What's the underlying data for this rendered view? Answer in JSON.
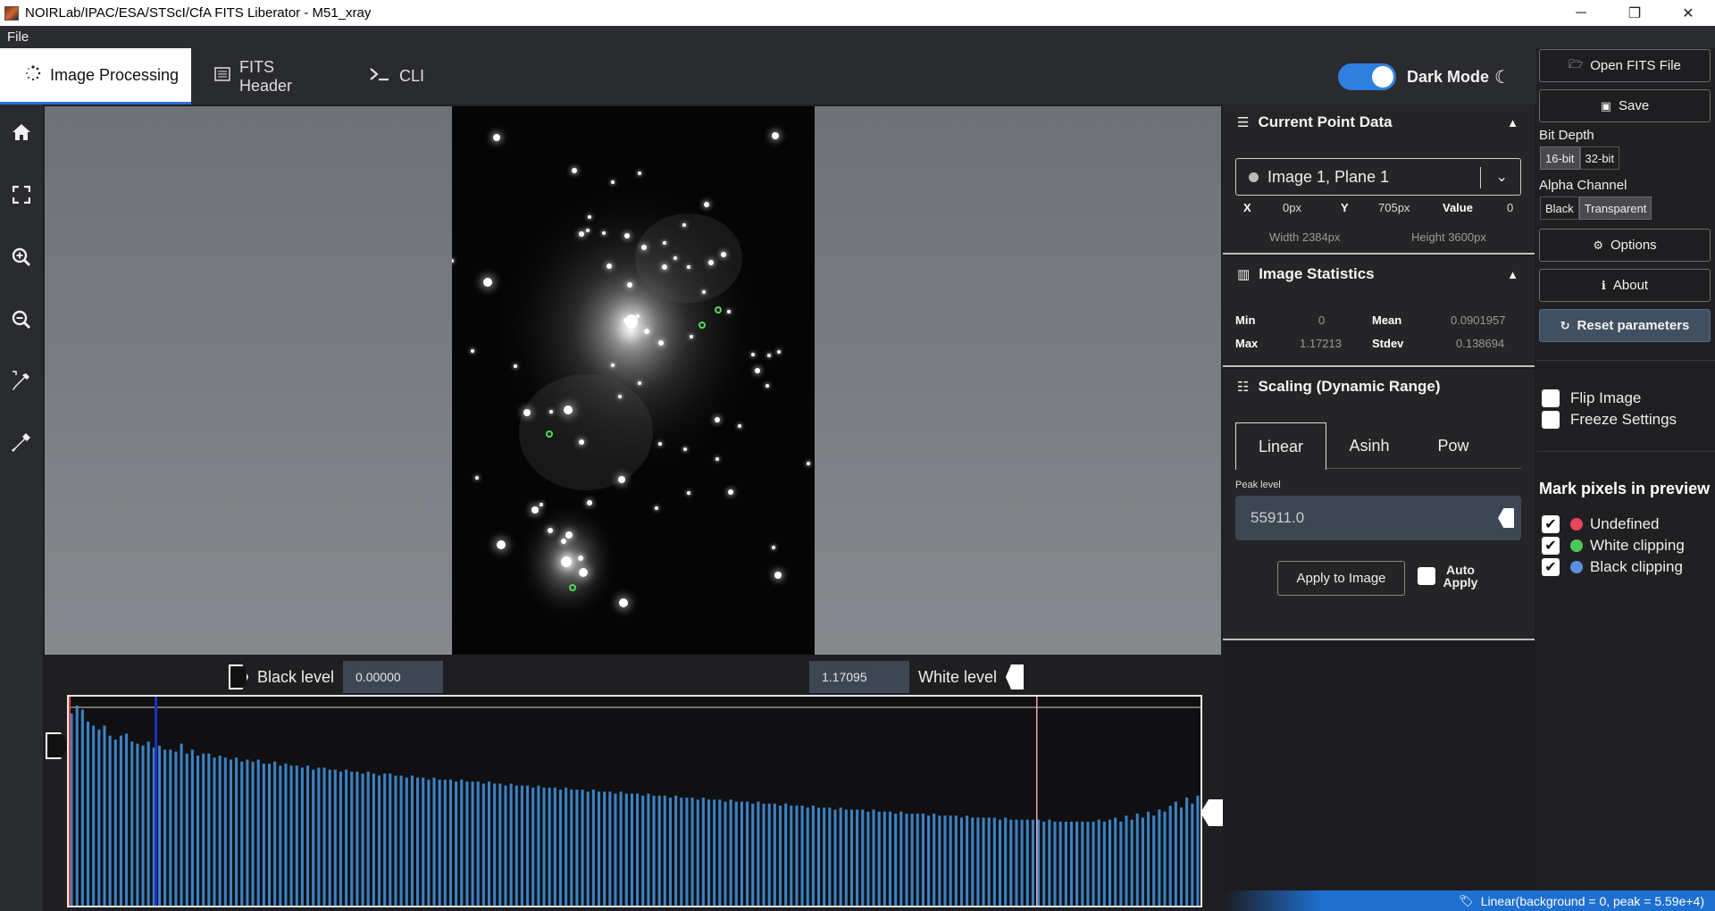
{
  "window": {
    "title": "NOIRLab/IPAC/ESA/STScI/CfA FITS Liberator - M51_xray",
    "minimize": "─",
    "restore": "❐",
    "close": "✕"
  },
  "menu": {
    "file": "File"
  },
  "tabs": [
    {
      "label": "Image Processing",
      "icon": "spinner-icon"
    },
    {
      "label": "FITS Header",
      "icon": "list-icon"
    },
    {
      "label": "CLI",
      "icon": "terminal-icon"
    }
  ],
  "dark_mode": {
    "label": "Dark Mode",
    "enabled": true
  },
  "toolbar": [
    "home-icon",
    "fit-screen-icon",
    "zoom-in-icon",
    "zoom-out-icon",
    "eyedropper-icon",
    "eyedropper-filled-icon"
  ],
  "levels": {
    "black_label": "Black level",
    "black_value": "0.00000",
    "white_label": "White level",
    "white_value": "1.17095"
  },
  "point_data": {
    "title": "Current Point Data",
    "plane": "Image 1, Plane 1",
    "x_label": "X",
    "x_value": "0px",
    "y_label": "Y",
    "y_value": "705px",
    "value_label": "Value",
    "value": "0",
    "width": "Width 2384px",
    "height": "Height 3600px"
  },
  "statistics": {
    "title": "Image Statistics",
    "min_label": "Min",
    "min": "0",
    "mean_label": "Mean",
    "mean": "0.0901957",
    "max_label": "Max",
    "max": "1.17213",
    "stdev_label": "Stdev",
    "stdev": "0.138694"
  },
  "scaling": {
    "title": "Scaling (Dynamic Range)",
    "tabs": [
      "Linear",
      "Asinh",
      "Pow"
    ],
    "active": "Linear",
    "peak_label": "Peak level",
    "peak_value": "55911.0",
    "apply": "Apply to Image",
    "auto_apply": "Auto Apply"
  },
  "actions": {
    "open": "Open FITS File",
    "save": "Save",
    "bit_depth_label": "Bit Depth",
    "bit_depth": [
      "16-bit",
      "32-bit"
    ],
    "alpha_label": "Alpha Channel",
    "alpha": [
      "Black",
      "Transparent"
    ],
    "options": "Options",
    "about": "About",
    "reset": "Reset parameters",
    "flip": "Flip Image",
    "freeze": "Freeze Settings",
    "mark_title": "Mark pixels in preview",
    "marks": [
      {
        "label": "Undefined",
        "color": "#e8455a"
      },
      {
        "label": "White clipping",
        "color": "#4cc85a"
      },
      {
        "label": "Black clipping",
        "color": "#5b8fe0"
      }
    ]
  },
  "status": {
    "text": "Linear(background = 0, peak = 5.59e+4)"
  },
  "colors": {
    "accent": "#2f7fe0",
    "histogram_bar": "#3b82c4",
    "histogram_black": "#e04040",
    "histogram_white": "#e7a7b0"
  },
  "chart_data": {
    "type": "bar",
    "title": "",
    "values": [
      96,
      100,
      98,
      92,
      90,
      88,
      90,
      85,
      83,
      85,
      86,
      82,
      81,
      80,
      82,
      79,
      80,
      78,
      78,
      77,
      81,
      76,
      78,
      75,
      76,
      76,
      74,
      75,
      74,
      73,
      74,
      72,
      73,
      72,
      73,
      71,
      71,
      72,
      70,
      71,
      70,
      70,
      69,
      70,
      68,
      69,
      69,
      68,
      68,
      67,
      68,
      67,
      67,
      66,
      67,
      66,
      65,
      66,
      66,
      65,
      65,
      64,
      65,
      64,
      64,
      63,
      64,
      63,
      63,
      63,
      62,
      63,
      62,
      62,
      62,
      61,
      62,
      61,
      61,
      60,
      61,
      60,
      60,
      60,
      59,
      60,
      59,
      59,
      59,
      58,
      59,
      58,
      58,
      58,
      57,
      58,
      57,
      57,
      57,
      56,
      57,
      56,
      56,
      56,
      55,
      56,
      55,
      55,
      55,
      54,
      55,
      54,
      54,
      54,
      53,
      54,
      53,
      53,
      53,
      52,
      53,
      52,
      52,
      52,
      51,
      52,
      51,
      51,
      51,
      50,
      51,
      50,
      50,
      50,
      49,
      50,
      49,
      49,
      49,
      48,
      49,
      48,
      48,
      48,
      48,
      47,
      48,
      47,
      47,
      47,
      46,
      47,
      46,
      46,
      46,
      46,
      45,
      46,
      45,
      45,
      45,
      45,
      44,
      45,
      44,
      44,
      44,
      44,
      44,
      43,
      44,
      43,
      43,
      43,
      43,
      43,
      43,
      42,
      43,
      42,
      42,
      42,
      42,
      42,
      42,
      42,
      42,
      43,
      42,
      43,
      44,
      42,
      45,
      43,
      46,
      44,
      47,
      45,
      48,
      47,
      50,
      52,
      49,
      54,
      51,
      55
    ]
  }
}
